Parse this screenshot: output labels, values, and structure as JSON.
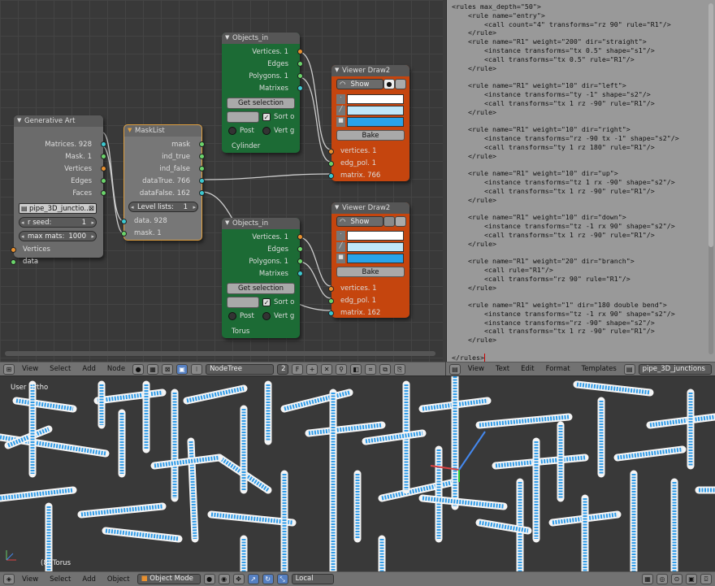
{
  "node_editor": {
    "nodes": {
      "generative_art": {
        "title": "Generative Art",
        "outputs": [
          "Matrices. 928",
          "Mask. 1",
          "Vertices",
          "Edges",
          "Faces"
        ],
        "file": "pipe_3D_junctio...",
        "rseed_label": "r seed:",
        "rseed_value": "1",
        "maxmats_label": "max mats:",
        "maxmats_value": "1000",
        "inputs": [
          "Vertices",
          "data"
        ]
      },
      "masklist": {
        "title": "MaskList",
        "outputs": [
          "mask",
          "ind_true",
          "ind_false",
          "dataTrue. 766",
          "dataFalse. 162"
        ],
        "level_label": "Level lists:",
        "level_value": "1",
        "inputs": [
          "data. 928",
          "mask. 1"
        ]
      },
      "objects_in_1": {
        "title": "Objects_in",
        "outputs": [
          "Vertices. 1",
          "Edges",
          "Polygons. 1",
          "Matrixes"
        ],
        "get_selection": "Get selection",
        "sort_label": "Sort o",
        "post_label": "Post",
        "vertg_label": "Vert g",
        "object_name": "Cylinder"
      },
      "objects_in_2": {
        "title": "Objects_in",
        "outputs": [
          "Vertices. 1",
          "Edges",
          "Polygons. 1",
          "Matrixes"
        ],
        "get_selection": "Get selection",
        "sort_label": "Sort o",
        "post_label": "Post",
        "vertg_label": "Vert g",
        "object_name": "Torus"
      },
      "viewer_draw_1": {
        "title": "Viewer Draw2",
        "show_label": "Show",
        "bake_label": "Bake",
        "inputs": [
          "vertices. 1",
          "edg_pol. 1",
          "matrix. 766"
        ]
      },
      "viewer_draw_2": {
        "title": "Viewer Draw2",
        "show_label": "Show",
        "bake_label": "Bake",
        "inputs": [
          "vertices. 1",
          "edg_pol. 1",
          "matrix. 162"
        ]
      }
    },
    "toolbar": {
      "menus": [
        "View",
        "Select",
        "Add",
        "Node"
      ],
      "tree_name": "NodeTree",
      "users": "2",
      "fake_user": "F"
    }
  },
  "text_editor": {
    "lines": [
      "<rules max_depth=\"50\">",
      "    <rule name=\"entry\">",
      "        <call count=\"4\" transforms=\"rz 90\" rule=\"R1\"/>",
      "    </rule>",
      "    <rule name=\"R1\" weight=\"200\" dir=\"straight\">",
      "        <instance transforms=\"tx 0.5\" shape=\"s1\"/>",
      "        <call transforms=\"tx 0.5\" rule=\"R1\"/>",
      "    </rule>",
      "",
      "    <rule name=\"R1\" weight=\"10\" dir=\"left\">",
      "        <instance transforms=\"ty -1\" shape=\"s2\"/>",
      "        <call transforms=\"tx 1 rz -90\" rule=\"R1\"/>",
      "    </rule>",
      "",
      "    <rule name=\"R1\" weight=\"10\" dir=\"right\">",
      "        <instance transforms=\"rz -90 tx -1\" shape=\"s2\"/>",
      "        <call transforms=\"ty 1 rz 180\" rule=\"R1\"/>",
      "    </rule>",
      "",
      "    <rule name=\"R1\" weight=\"10\" dir=\"up\">",
      "        <instance transforms=\"tz 1 rx -90\" shape=\"s2\"/>",
      "        <call transforms=\"tx 1 rz -90\" rule=\"R1\"/>",
      "    </rule>",
      "",
      "    <rule name=\"R1\" weight=\"10\" dir=\"down\">",
      "        <instance transforms=\"tz -1 rx 90\" shape=\"s2\"/>",
      "        <call transforms=\"tx 1 rz -90\" rule=\"R1\"/>",
      "    </rule>",
      "",
      "    <rule name=\"R1\" weight=\"20\" dir=\"branch\">",
      "        <call rule=\"R1\"/>",
      "        <call transforms=\"rz 90\" rule=\"R1\"/>",
      "    </rule>",
      "",
      "    <rule name=\"R1\" weight=\"1\" dir=\"180 double bend\">",
      "        <instance transforms=\"tz -1 rx 90\" shape=\"s2\"/>",
      "        <instance transforms=\"rz -90\" shape=\"s2\"/>",
      "        <call transforms=\"tx 1 rz -90\" rule=\"R1\"/>",
      "    </rule>",
      "",
      "</rules>"
    ],
    "toolbar": {
      "menus": [
        "View",
        "Text",
        "Edit",
        "Format",
        "Templates"
      ],
      "file_name": "pipe_3D_junctions"
    }
  },
  "viewport": {
    "view_label": "User Ortho",
    "object_label": "(8) Torus",
    "toolbar": {
      "menus": [
        "View",
        "Select",
        "Add",
        "Object"
      ],
      "mode": "Object Mode",
      "orientation": "Local"
    }
  },
  "colors": {
    "pipe_blue": "#2f9be8",
    "pipe_white": "#f4f4f4",
    "node_green": "#1c6b35",
    "node_orange": "#c5450e",
    "socket_green": "#6bd46b",
    "socket_orange": "#e8902f",
    "socket_cyan": "#3cc8d0"
  }
}
